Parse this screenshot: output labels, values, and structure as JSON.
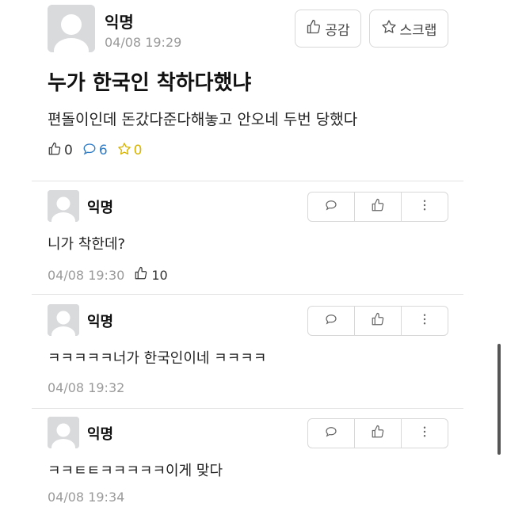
{
  "post": {
    "author": "익명",
    "time": "04/08 19:29",
    "buttons": {
      "like": "공감",
      "scrap": "스크랩"
    },
    "title": "누가 한국인 착하다했냐",
    "body": "편돌이인데 돈갔다준다해놓고 안오네 두번 당했다",
    "stats": {
      "likes": "0",
      "comments": "6",
      "scraps": "0"
    }
  },
  "comments": [
    {
      "author": "익명",
      "text": "니가 착한데?",
      "time": "04/08 19:30",
      "likes": "10"
    },
    {
      "author": "익명",
      "text": "ㅋㅋㅋㅋㅋ너가 한국인이네 ㅋㅋㅋㅋ",
      "time": "04/08 19:32"
    },
    {
      "author": "익명",
      "text": "ㅋㅋㅌㅌㅋㅋㅋㅋㅋ이게 맞다",
      "time": "04/08 19:34"
    }
  ],
  "colors": {
    "accent_comment": "#2e7bc6",
    "accent_scrap": "#d6b400",
    "avatar_bg": "#d9dadc"
  },
  "icons": [
    "thumbs-up-icon",
    "star-icon",
    "speech-bubble-icon",
    "more-vertical-icon",
    "avatar-icon"
  ]
}
